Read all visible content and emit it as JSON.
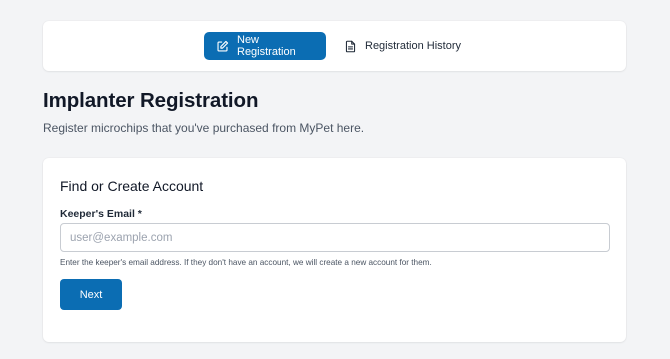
{
  "nav": {
    "tabs": [
      {
        "label": "New Registration",
        "icon": "edit-icon",
        "active": true
      },
      {
        "label": "Registration History",
        "icon": "document-icon",
        "active": false
      }
    ]
  },
  "header": {
    "title": "Implanter Registration",
    "subtitle": "Register microchips that you've purchased from MyPet here."
  },
  "form": {
    "title": "Find or Create Account",
    "email_label": "Keeper's Email *",
    "email_value": "",
    "email_placeholder": "user@example.com",
    "help_text": "Enter the keeper's email address. If they don't have an account, we will create a new account for them.",
    "next_label": "Next"
  },
  "colors": {
    "accent": "#0b6db3",
    "background": "#f3f4f6",
    "card": "#ffffff"
  }
}
